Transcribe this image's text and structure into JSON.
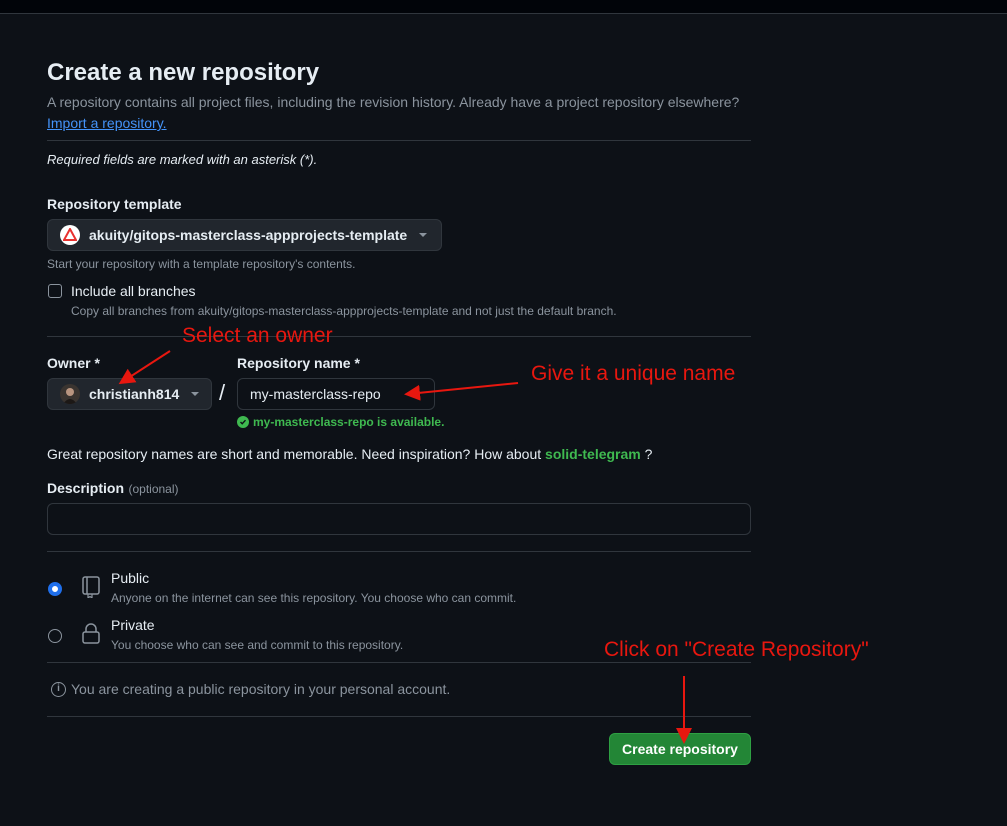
{
  "header": {
    "title": "Create a new repository",
    "subtitle": "A repository contains all project files, including the revision history. Already have a project repository elsewhere?",
    "import_link": "Import a repository."
  },
  "required_note": "Required fields are marked with an asterisk (*).",
  "template": {
    "label": "Repository template",
    "selected": "akuity/gitops-masterclass-appprojects-template",
    "hint": "Start your repository with a template repository's contents.",
    "include_branches_label": "Include all branches",
    "include_branches_hint": "Copy all branches from akuity/gitops-masterclass-appprojects-template and not just the default branch.",
    "include_branches_checked": false
  },
  "owner": {
    "label": "Owner *",
    "selected": "christianh814"
  },
  "separator": "/",
  "repo_name": {
    "label": "Repository name *",
    "value": "my-masterclass-repo",
    "availability": "my-masterclass-repo is available."
  },
  "inspiration": {
    "text": "Great repository names are short and memorable. Need inspiration? How about",
    "suggestion": "solid-telegram",
    "end": "?"
  },
  "description": {
    "label": "Description",
    "optional": "(optional)",
    "value": ""
  },
  "visibility": {
    "selected": "public",
    "public_label": "Public",
    "public_desc": "Anyone on the internet can see this repository. You choose who can commit.",
    "private_label": "Private",
    "private_desc": "You choose who can see and commit to this repository."
  },
  "info_note": "You are creating a public repository in your personal account.",
  "create_button": "Create repository",
  "annotations": {
    "owner": "Select an owner",
    "name": "Give it a unique name",
    "create": "Click on \"Create Repository\""
  },
  "colors": {
    "accent_green": "#238636",
    "annotation_red": "#e8170f",
    "link_blue": "#4493f8",
    "radio_blue": "#1f6feb"
  }
}
